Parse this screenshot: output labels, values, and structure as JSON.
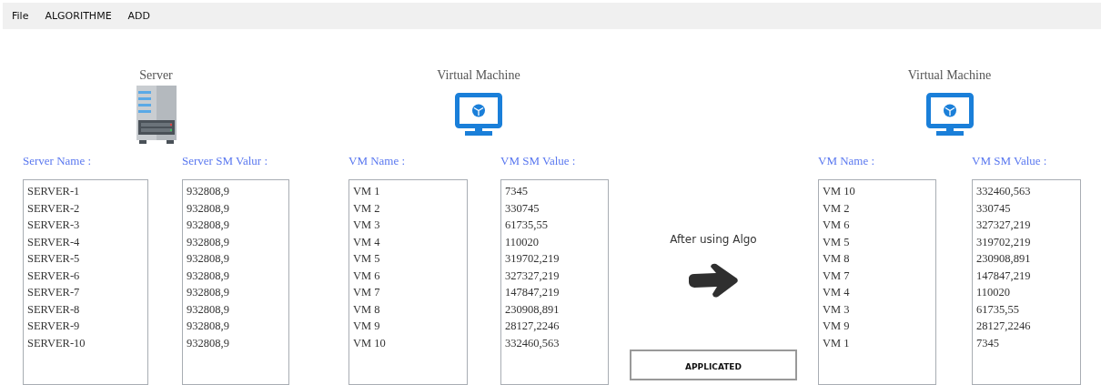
{
  "menu": [
    "File",
    "ALGORITHME",
    "ADD"
  ],
  "sections": [
    {
      "kind": "server-panel",
      "title": "Server",
      "columns": [
        {
          "label": "Server Name :",
          "items": [
            "SERVER-1",
            "SERVER-2",
            "SERVER-3",
            "SERVER-4",
            "SERVER-5",
            "SERVER-6",
            "SERVER-7",
            "SERVER-8",
            "SERVER-9",
            "SERVER-10"
          ]
        },
        {
          "label": "Server SM Valur :",
          "items": [
            "932808,9",
            "932808,9",
            "932808,9",
            "932808,9",
            "932808,9",
            "932808,9",
            "932808,9",
            "932808,9",
            "932808,9",
            "932808,9"
          ]
        }
      ]
    },
    {
      "kind": "vm-panel",
      "title": "Virtual Machine",
      "columns": [
        {
          "label": "VM Name :",
          "items": [
            "VM 1",
            "VM 2",
            "VM 3",
            "VM 4",
            "VM 5",
            "VM 6",
            "VM 7",
            "VM 8",
            "VM 9",
            "VM 10"
          ]
        },
        {
          "label": "VM SM Value :",
          "items": [
            "7345",
            "330745",
            "61735,55",
            "110020",
            "319702,219",
            "327327,219",
            "147847,219",
            "230908,891",
            "28127,2246",
            "332460,563"
          ]
        }
      ]
    },
    {
      "kind": "transition",
      "caption": "After using Algo",
      "button": "APPLICATED"
    },
    {
      "kind": "vm-panel",
      "title": "Virtual Machine",
      "columns": [
        {
          "label": "VM Name :",
          "items": [
            "VM 10",
            "VM 2",
            "VM 6",
            "VM 5",
            "VM 8",
            "VM 7",
            "VM 4",
            "VM 3",
            "VM 9",
            "VM 1"
          ]
        },
        {
          "label": "VM SM Value :",
          "items": [
            "332460,563",
            "330745",
            "327327,219",
            "319702,219",
            "230908,891",
            "147847,219",
            "110020",
            "61735,55",
            "28127,2246",
            "7345"
          ]
        }
      ]
    }
  ]
}
